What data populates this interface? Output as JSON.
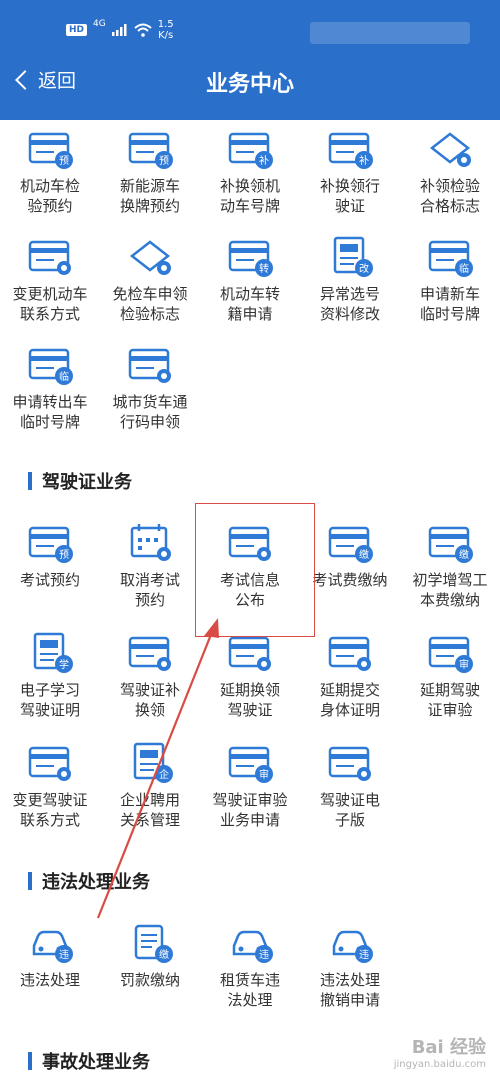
{
  "status_bar": {
    "hd": "HD",
    "network": "4G",
    "speed_value": "1.5",
    "speed_unit": "K/s"
  },
  "header": {
    "back_label": "返回",
    "title": "业务中心"
  },
  "vehicle_items": [
    {
      "label": "机动车检\n验预约",
      "icon": "inspection-card-icon",
      "badge": "预"
    },
    {
      "label": "新能源车\n换牌预约",
      "icon": "plate-card-icon",
      "badge": "预"
    },
    {
      "label": "补换领机\n动车号牌",
      "icon": "plate-card-icon",
      "badge": "补"
    },
    {
      "label": "补换领行\n驶证",
      "icon": "license-card-icon",
      "badge": "补"
    },
    {
      "label": "补领检验\n合格标志",
      "icon": "inspection-tag-icon",
      "badge": ""
    },
    {
      "label": "变更机动车\n联系方式",
      "icon": "vehicle-card-icon",
      "badge": ""
    },
    {
      "label": "免检车申领\n检验标志",
      "icon": "exempt-tag-icon",
      "badge": ""
    },
    {
      "label": "机动车转\n籍申请",
      "icon": "transfer-card-icon",
      "badge": "转"
    },
    {
      "label": "异常选号\n资料修改",
      "icon": "document-edit-icon",
      "badge": "改"
    },
    {
      "label": "申请新车\n临时号牌",
      "icon": "temp-plate-icon",
      "badge": "临"
    },
    {
      "label": "申请转出车\n临时号牌",
      "icon": "export-temp-plate-icon",
      "badge": "临"
    },
    {
      "label": "城市货车通\n行码申领",
      "icon": "truck-pass-icon",
      "badge": ""
    }
  ],
  "driving_license_section": {
    "title": "驾驶证业务"
  },
  "license_items": [
    {
      "label": "考试预约",
      "icon": "exam-card-icon",
      "badge": "预"
    },
    {
      "label": "取消考试\n预约",
      "icon": "calendar-cancel-icon",
      "badge": ""
    },
    {
      "label": "考试信息\n公布",
      "icon": "exam-info-icon",
      "badge": ""
    },
    {
      "label": "考试费缴纳",
      "icon": "exam-fee-icon",
      "badge": "缴"
    },
    {
      "label": "初学增驾工\n本费缴纳",
      "icon": "id-card-fee-icon",
      "badge": "缴"
    },
    {
      "label": "电子学习\n驾驶证明",
      "icon": "learner-doc-icon",
      "badge": "学"
    },
    {
      "label": "驾驶证补\n换领",
      "icon": "license-renew-icon",
      "badge": ""
    },
    {
      "label": "延期换领\n驾驶证",
      "icon": "delay-license-icon",
      "badge": ""
    },
    {
      "label": "延期提交\n身体证明",
      "icon": "health-cert-icon",
      "badge": ""
    },
    {
      "label": "延期驾驶\n证审验",
      "icon": "delay-review-icon",
      "badge": "审"
    },
    {
      "label": "变更驾驶证\n联系方式",
      "icon": "contact-change-icon",
      "badge": ""
    },
    {
      "label": "企业聘用\n关系管理",
      "icon": "enterprise-doc-icon",
      "badge": "企"
    },
    {
      "label": "驾驶证审验\n业务申请",
      "icon": "review-apply-icon",
      "badge": "审"
    },
    {
      "label": "驾驶证电\n子版",
      "icon": "e-license-icon",
      "badge": ""
    }
  ],
  "violation_section": {
    "title": "违法处理业务"
  },
  "violation_items": [
    {
      "label": "违法处理",
      "icon": "car-violation-icon",
      "badge": "违"
    },
    {
      "label": "罚款缴纳",
      "icon": "fine-scroll-icon",
      "badge": "缴"
    },
    {
      "label": "租赁车违\n法处理",
      "icon": "rental-car-icon",
      "badge": "违"
    },
    {
      "label": "违法处理\n撤销申请",
      "icon": "revoke-car-icon",
      "badge": "违"
    }
  ],
  "accident_section": {
    "title": "事故处理业务"
  },
  "watermark": {
    "main": "Bai 经验",
    "sub": "jingyan.baidu.com"
  },
  "colors": {
    "primary": "#2a6fc9",
    "icon_blue": "#2f7ad6",
    "highlight": "#d94b45"
  }
}
